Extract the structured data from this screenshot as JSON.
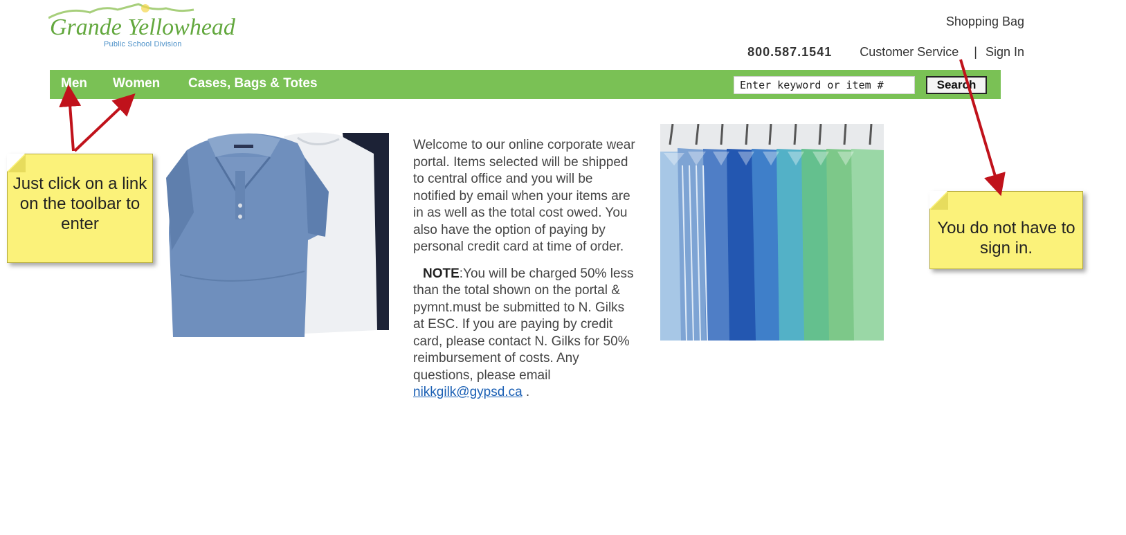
{
  "header": {
    "logo_title": "Grande Yellowhead",
    "logo_subtitle": "Public School Division",
    "shopping_bag": "Shopping Bag",
    "phone": "800.587.1541",
    "customer_service": "Customer Service",
    "separator": "|",
    "sign_in": "Sign In"
  },
  "nav": {
    "items": [
      {
        "label": "Men"
      },
      {
        "label": "Women"
      },
      {
        "label": "Cases, Bags & Totes"
      }
    ],
    "search": {
      "placeholder": "Enter keyword or item #",
      "button_label": "Search"
    }
  },
  "main": {
    "intro": "Welcome to our online corporate wear portal.  Items selected will be shipped to central office and you will be notified by email when your items are in as well as the total cost owed. You also have the option of paying by personal credit card at time of order.",
    "note_label": "NOTE",
    "note_text": ":You will be charged 50% less than the total shown on the portal & pymnt.must be submitted to N. Gilks at ESC. If you are paying by credit card, please contact N. Gilks for 50% reimbursement of costs. Any questions, please email",
    "email": "nikkgilk@gypsd.ca",
    "email_suffix": "."
  },
  "callouts": {
    "left": "Just click on a link on the toolbar to enter",
    "right": "You do not have to sign in."
  },
  "colors": {
    "nav_green": "#7ac155",
    "callout_yellow": "#fbf27a",
    "arrow_red": "#c0121b"
  }
}
